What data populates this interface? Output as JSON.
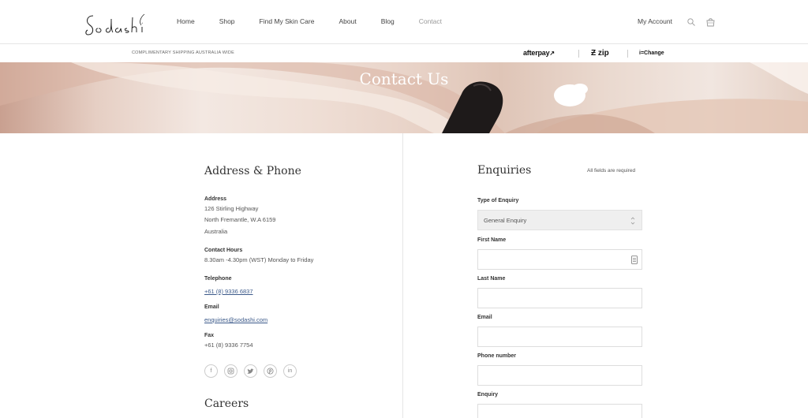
{
  "header": {
    "logo_text": "Sodashi",
    "nav": [
      {
        "label": "Home"
      },
      {
        "label": "Shop"
      },
      {
        "label": "Find My Skin Care"
      },
      {
        "label": "About"
      },
      {
        "label": "Blog"
      },
      {
        "label": "Contact"
      }
    ],
    "account_label": "My Account"
  },
  "strip": {
    "shipping_text": "COMPLIMENTARY SHIPPING AUSTRALIA WIDE",
    "payments": [
      "afterpay",
      "zip",
      "i=Change"
    ]
  },
  "hero": {
    "title": "Contact Us"
  },
  "contact": {
    "heading": "Address & Phone",
    "address_label": "Address",
    "address_lines": [
      "126 Stirling Highway",
      "North Fremantle, W.A 6159",
      "Australia"
    ],
    "hours_label": "Contact Hours",
    "hours_text": "8.30am -4.30pm (WST) Monday to Friday",
    "telephone_label": "Telephone",
    "telephone": "+61 (8) 9336 6837",
    "email_label": "Email",
    "email": "enquiries@sodashi.com",
    "fax_label": "Fax",
    "fax": "+61 (8) 9336 7754",
    "socials": [
      "f",
      "instagram",
      "twitter",
      "pinterest",
      "in"
    ],
    "careers_heading": "Careers"
  },
  "form": {
    "heading": "Enquiries",
    "required_note": "All fields are required",
    "type_label": "Type of Enquiry",
    "type_value": "General Enquiry",
    "first_name_label": "First Name",
    "last_name_label": "Last Name",
    "email_label": "Email",
    "phone_label": "Phone number",
    "enquiry_label": "Enquiry"
  },
  "colors": {
    "link": "#3c5a8a",
    "text": "#333333",
    "muted": "#999999"
  }
}
